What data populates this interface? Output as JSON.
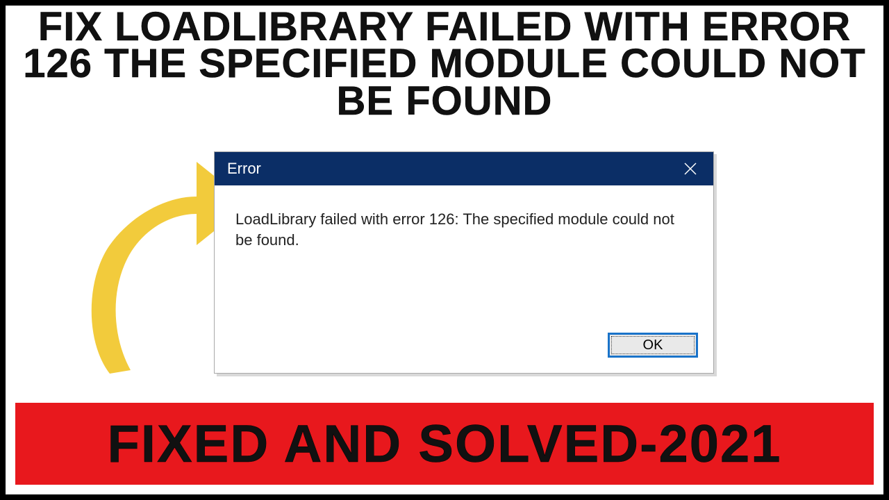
{
  "headline": "FIX LOADLIBRARY FAILED WITH ERROR 126 THE SPECIFIED MODULE COULD NOT BE FOUND",
  "dialog": {
    "title": "Error",
    "message": "LoadLibrary failed with error 126: The specified module could not be found.",
    "ok_label": "OK"
  },
  "banner": "FIXED AND SOLVED-2021",
  "colors": {
    "titlebar": "#0b2e66",
    "banner_bg": "#e8181d",
    "arrow": "#f2cb3c"
  }
}
